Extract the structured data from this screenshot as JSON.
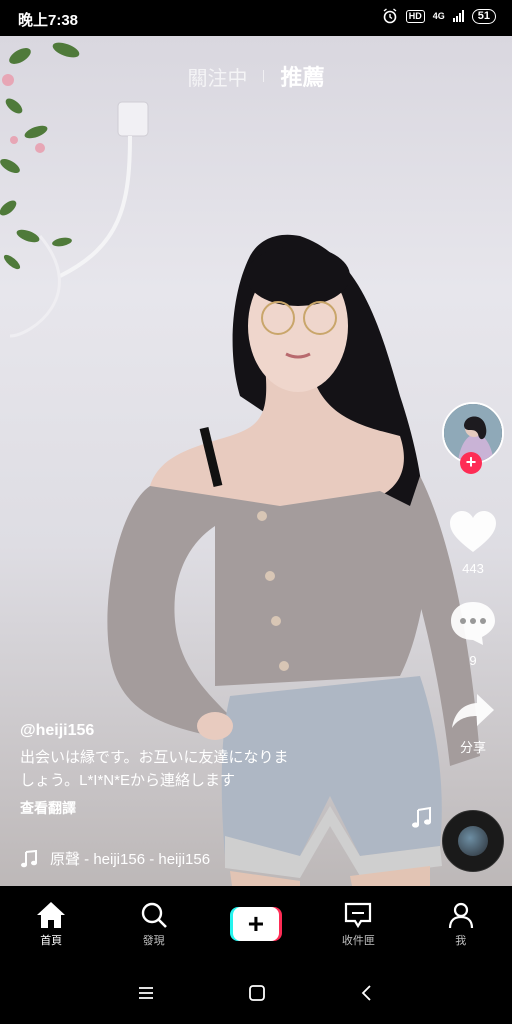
{
  "status_bar": {
    "time": "晚上7:38",
    "battery": "51",
    "network": "4G",
    "hd": "HD"
  },
  "top_tabs": {
    "following": "關注中",
    "recommended": "推薦"
  },
  "actions": {
    "likes": "443",
    "comments": "9",
    "share_label": "分享"
  },
  "post": {
    "username": "@heiji156",
    "description_line1": "出会いは縁です。お互いに友達になりま",
    "description_line2": "しょう。L*I*N*Eから連絡します",
    "translate_label": "查看翻譯",
    "music": "原聲 - heiji156 - heiji156"
  },
  "bottom_nav": {
    "home": "首頁",
    "discover": "發現",
    "inbox": "收件匣",
    "me": "我"
  },
  "colors": {
    "accent": "#fe2c55",
    "cyan": "#25f4ee"
  }
}
